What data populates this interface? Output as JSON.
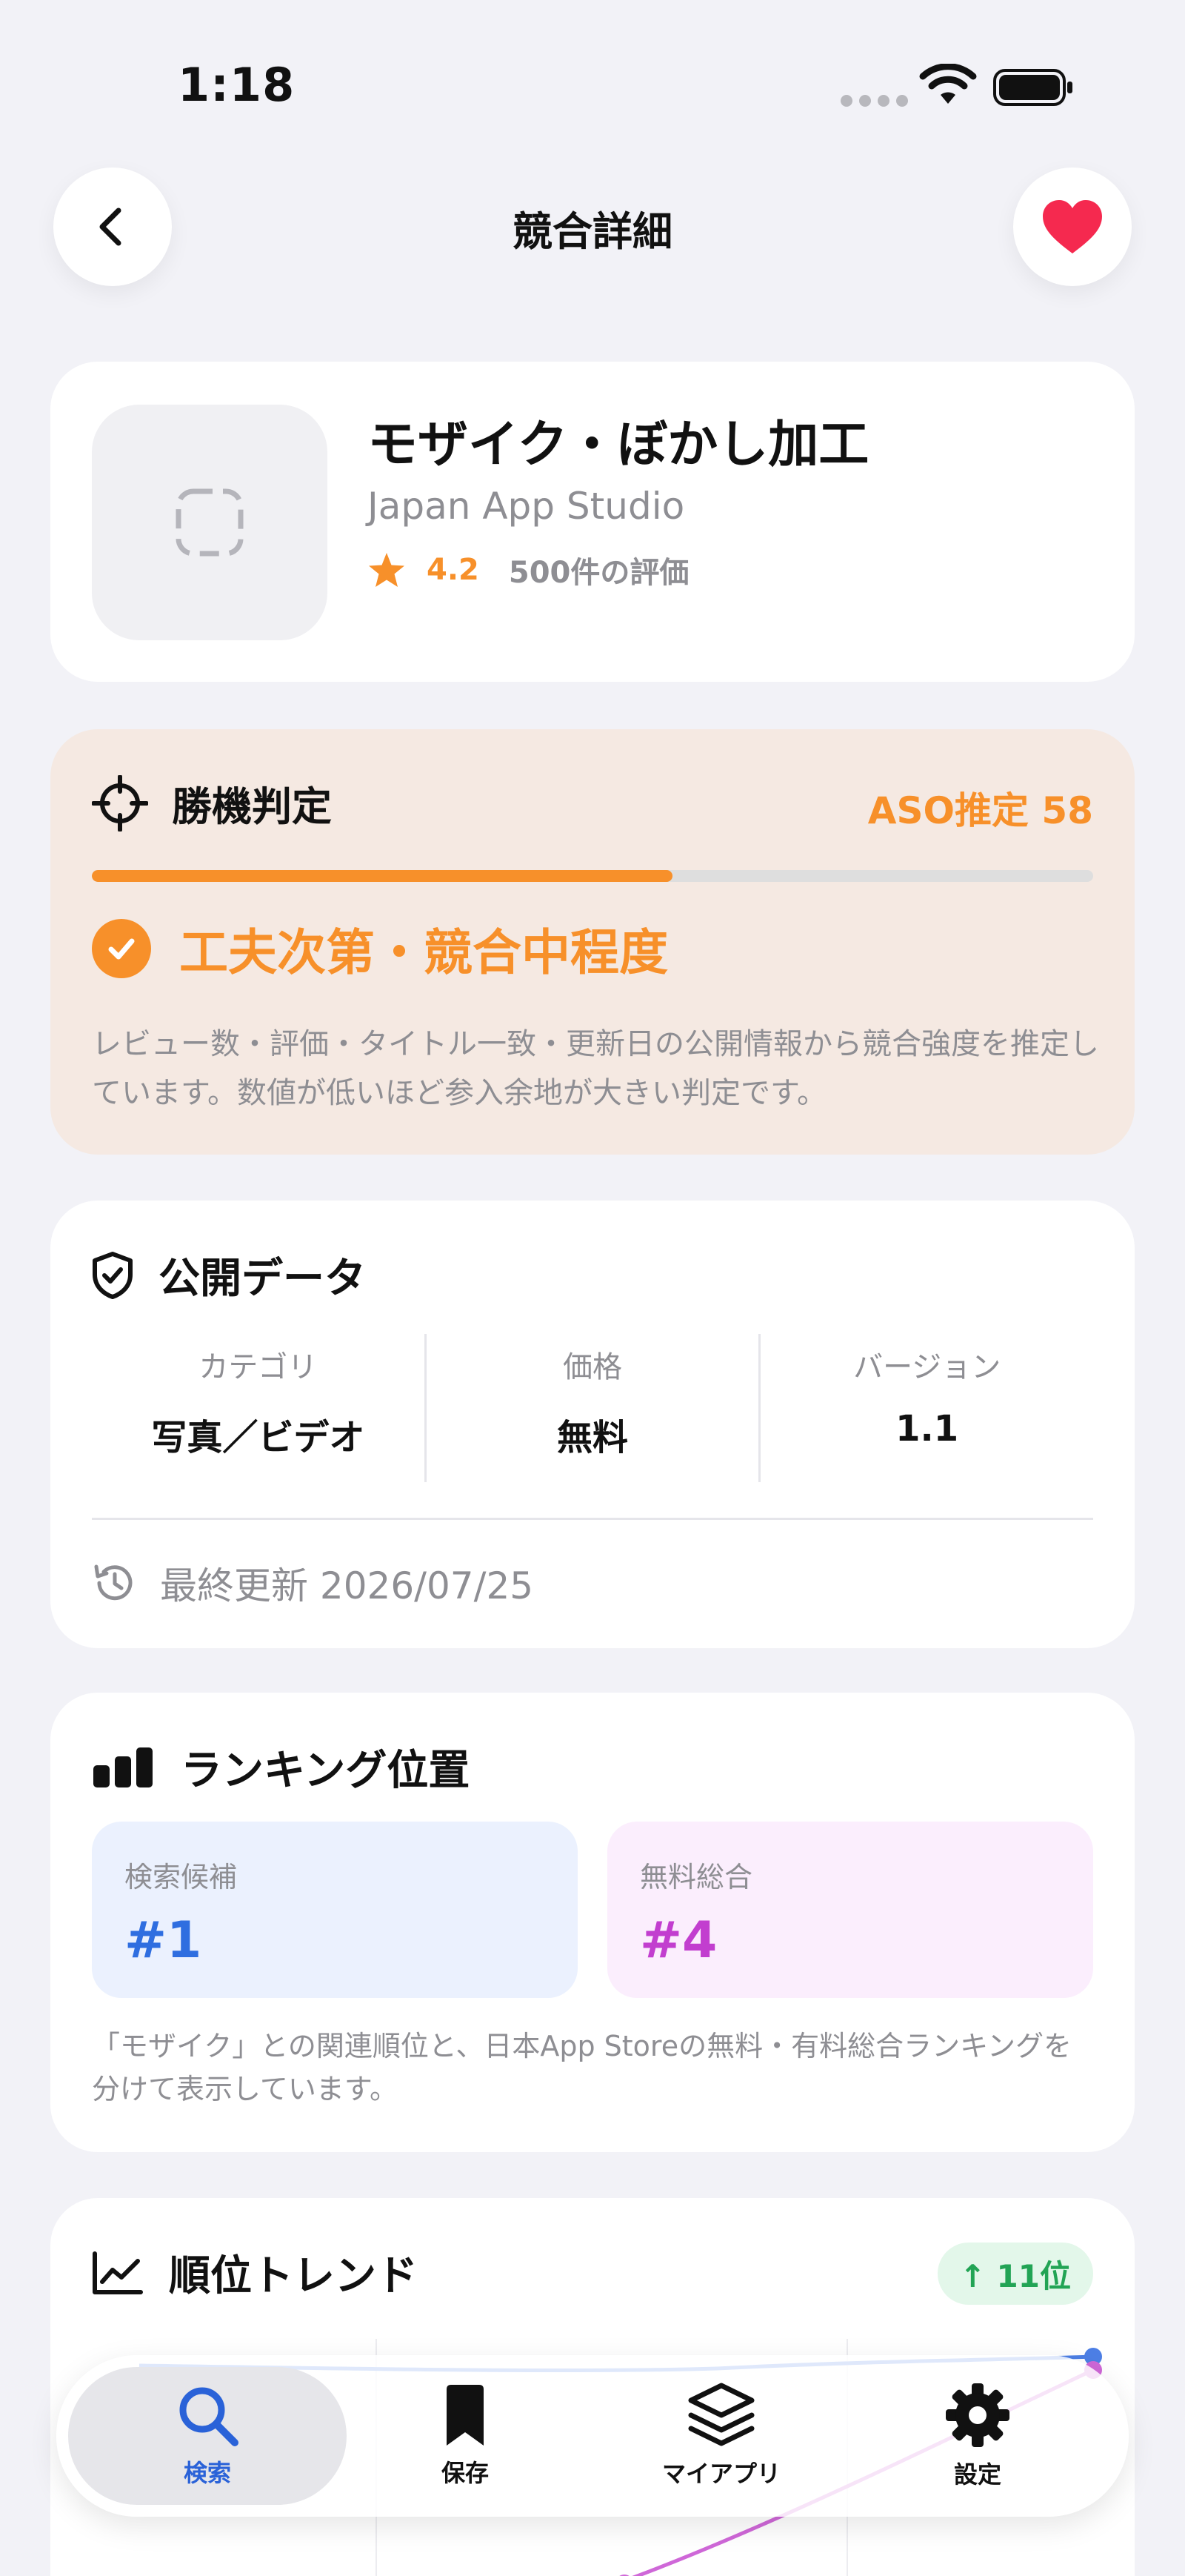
{
  "status_bar": {
    "time": "1:18"
  },
  "nav": {
    "title": "競合詳細",
    "back_icon": "chevron-left-icon",
    "favorite_icon": "heart-icon"
  },
  "app": {
    "name": "モザイク・ぼかし加工",
    "developer": "Japan App Studio",
    "rating": "4.2",
    "rating_count": "500件の評価"
  },
  "judgement": {
    "title": "勝機判定",
    "aso_label": "ASO推定 58",
    "aso_score_fraction": 0.58,
    "verdict": "工夫次第・競合中程度",
    "description": "レビュー数・評価・タイトル一致・更新日の公開情報から競合強度を推定しています。数値が低いほど参入余地が大きい判定です。",
    "accent_color": "#f7902a"
  },
  "public_data": {
    "title": "公開データ",
    "columns": [
      {
        "label": "カテゴリ",
        "value": "写真／ビデオ"
      },
      {
        "label": "価格",
        "value": "無料"
      },
      {
        "label": "バージョン",
        "value": "1.1"
      }
    ],
    "last_updated": "最終更新 2026/07/25"
  },
  "ranking": {
    "title": "ランキング位置",
    "search": {
      "label": "検索候補",
      "value": "#1",
      "color": "#2f6ee0"
    },
    "free_overall": {
      "label": "無料総合",
      "value": "#4",
      "color": "#c23ecf"
    },
    "description": "「モザイク」との関連順位と、日本App Storeの無料・有料総合ランキングを分けて表示しています。"
  },
  "trend": {
    "title": "順位トレンド",
    "badge": "↑ 11位",
    "badge_color": "#22a455"
  },
  "tabs": [
    {
      "label": "検索",
      "icon": "search-icon",
      "active": true
    },
    {
      "label": "保存",
      "icon": "bookmark-icon",
      "active": false
    },
    {
      "label": "マイアプリ",
      "icon": "layers-icon",
      "active": false
    },
    {
      "label": "設定",
      "icon": "gear-icon",
      "active": false
    }
  ]
}
